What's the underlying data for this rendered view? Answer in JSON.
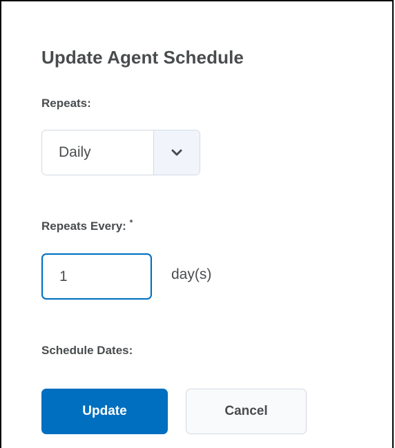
{
  "dialog": {
    "title": "Update Agent Schedule"
  },
  "repeats": {
    "label": "Repeats:",
    "selected": "Daily"
  },
  "repeats_every": {
    "label": "Repeats Every:",
    "required_marker": "*",
    "value": "1",
    "unit": "day(s)"
  },
  "schedule_dates": {
    "label": "Schedule Dates:"
  },
  "buttons": {
    "update": "Update",
    "cancel": "Cancel"
  },
  "icons": {
    "dropdown": "chevron-down-icon"
  },
  "colors": {
    "primary": "#006fbf",
    "text": "#494c4e",
    "border": "#d3d9e3"
  }
}
